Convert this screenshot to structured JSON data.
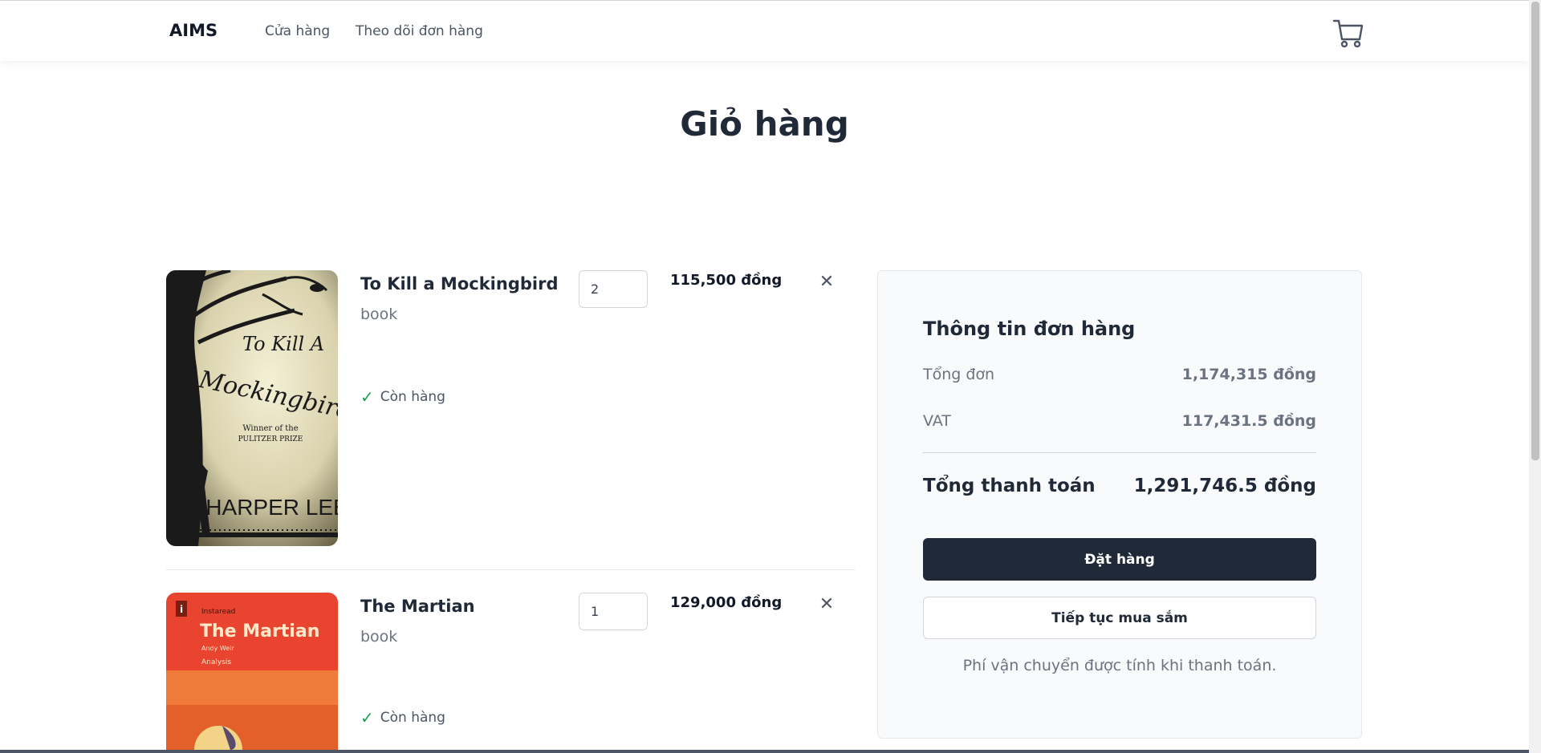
{
  "nav": {
    "brand": "AIMS",
    "links": [
      "Cửa hàng",
      "Theo dõi đơn hàng"
    ],
    "cart_icon": "cart-icon"
  },
  "page": {
    "title": "Giỏ hàng"
  },
  "items": [
    {
      "name": "To Kill a Mockingbird",
      "type": "book",
      "quantity": "2",
      "price": "115,500 đồng",
      "stock": "Còn hàng",
      "cover": {
        "title_line1": "To Kill A",
        "title_line2": "Mockingbird",
        "award_line1": "Winner of the",
        "award_line2": "PULITZER PRIZE",
        "author": "HARPER LEE"
      }
    },
    {
      "name": "The Martian",
      "type": "book",
      "quantity": "1",
      "price": "129,000 đồng",
      "stock": "Còn hàng",
      "cover": {
        "brand": "Instaread",
        "title": "The Martian",
        "author": "Andy Weir",
        "subtitle": "Analysis"
      }
    }
  ],
  "summary": {
    "title": "Thông tin đơn hàng",
    "subtotal_label": "Tổng đơn",
    "subtotal_value": "1,174,315 đồng",
    "vat_label": "VAT",
    "vat_value": "117,431.5 đồng",
    "total_label": "Tổng thanh toán",
    "total_value": "1,291,746.5 đồng",
    "order_button": "Đặt hàng",
    "continue_button": "Tiếp tục mua sắm",
    "note": "Phí vận chuyển được tính khi thanh toán."
  },
  "colors": {
    "primary": "#1f2937",
    "muted": "#6b7280",
    "success": "#16a34a",
    "summary_bg": "#f8fafc"
  }
}
